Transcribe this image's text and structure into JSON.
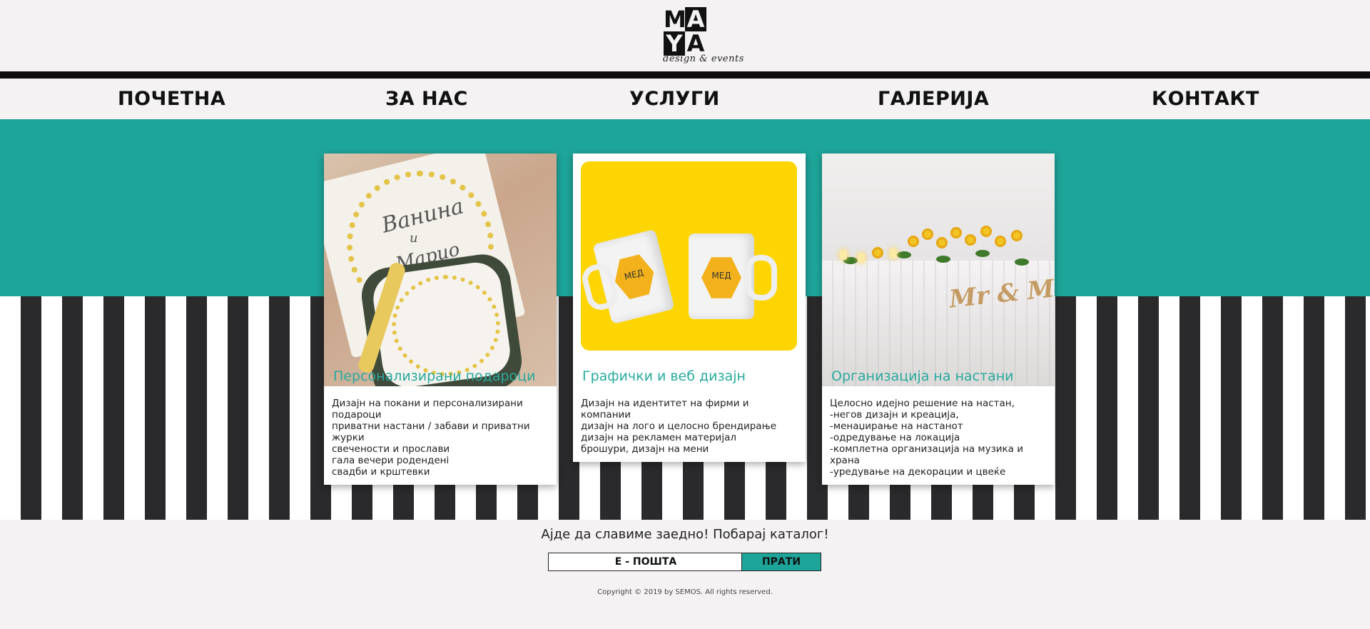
{
  "brand": {
    "logo_letters": [
      "M",
      "A",
      "Y",
      "A"
    ],
    "tagline": "design & events"
  },
  "nav": {
    "items": [
      "ПОЧЕТНА",
      "ЗА НАС",
      "УСЛУГИ",
      "ГАЛЕРИЈА",
      "КОНТАКТ"
    ]
  },
  "cards": [
    {
      "title": "Персонализирани подароци",
      "lines": [
        "Дизајн на покани и персонализирани подароци",
        "приватни настани / забави и приватни журки",
        "свечености и прослави",
        "гала вечери роденденi",
        "свадби и крштевки"
      ],
      "image_script": [
        "Ванина",
        "и",
        "Марио"
      ]
    },
    {
      "title": "Графички и веб дизајн",
      "lines": [
        "Дизајн на идентитет на фирми и компании",
        "дизајн на лого и целосно брендирање",
        "дизајн на рекламен материјал",
        "брошури, дизајн на мени"
      ],
      "mug_label": "МЕД"
    },
    {
      "title": "Организација на настани",
      "lines": [
        "Целосно идејно решение на настан,",
        "-негов дизајн и креација,",
        "-менаџирање на настанот",
        "-одредување на локација",
        "-комплетна организација на музика и храна",
        "-уредување на декорации и цвеќе"
      ],
      "sign": "Mr & Mrs"
    }
  ],
  "footer": {
    "cta": "Ајде да славиме заедно! Побарај каталог!",
    "email_placeholder": "Е - ПОШТА",
    "send_label": "ПРАТИ",
    "copyright": "Copyright © 2019 by SEMOS. All rights reserved."
  },
  "colors": {
    "teal": "#1ea59a",
    "stripe_dark": "#2a2a2c",
    "background": "#f4f2f3",
    "mug_yellow": "#fdd503"
  }
}
